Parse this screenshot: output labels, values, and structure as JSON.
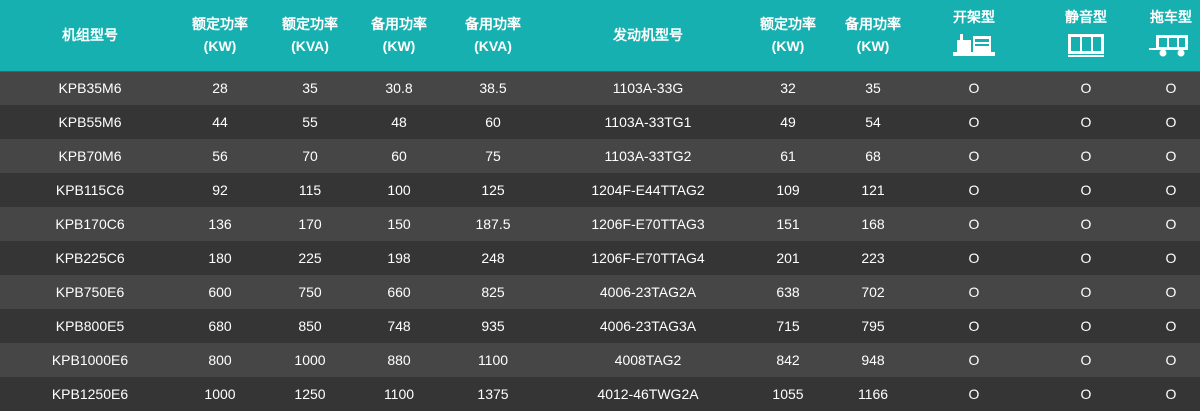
{
  "table": {
    "headers": {
      "model": "机组型号",
      "rated_kw": [
        "额定功率",
        "(KW)"
      ],
      "rated_kva": [
        "额定功率",
        "(KVA)"
      ],
      "standby_kw": [
        "备用功率",
        "(KW)"
      ],
      "standby_kva": [
        "备用功率",
        "(KVA)"
      ],
      "engine": "发动机型号",
      "engine_rated_kw": [
        "额定功率",
        "(KW)"
      ],
      "engine_standby_kw": [
        "备用功率",
        "(KW)"
      ],
      "open_frame": "开架型",
      "silent": "静音型",
      "trailer": "拖车型"
    },
    "rows": [
      [
        "KPB35M6",
        "28",
        "35",
        "30.8",
        "38.5",
        "1103A-33G",
        "32",
        "35",
        "O",
        "O",
        "O"
      ],
      [
        "KPB55M6",
        "44",
        "55",
        "48",
        "60",
        "1103A-33TG1",
        "49",
        "54",
        "O",
        "O",
        "O"
      ],
      [
        "KPB70M6",
        "56",
        "70",
        "60",
        "75",
        "1103A-33TG2",
        "61",
        "68",
        "O",
        "O",
        "O"
      ],
      [
        "KPB115C6",
        "92",
        "115",
        "100",
        "125",
        "1204F-E44TTAG2",
        "109",
        "121",
        "O",
        "O",
        "O"
      ],
      [
        "KPB170C6",
        "136",
        "170",
        "150",
        "187.5",
        "1206F-E70TTAG3",
        "151",
        "168",
        "O",
        "O",
        "O"
      ],
      [
        "KPB225C6",
        "180",
        "225",
        "198",
        "248",
        "1206F-E70TTAG4",
        "201",
        "223",
        "O",
        "O",
        "O"
      ],
      [
        "KPB750E6",
        "600",
        "750",
        "660",
        "825",
        "4006-23TAG2A",
        "638",
        "702",
        "O",
        "O",
        "O"
      ],
      [
        "KPB800E5",
        "680",
        "850",
        "748",
        "935",
        "4006-23TAG3A",
        "715",
        "795",
        "O",
        "O",
        "O"
      ],
      [
        "KPB1000E6",
        "800",
        "1000",
        "880",
        "1100",
        "4008TAG2",
        "842",
        "948",
        "O",
        "O",
        "O"
      ],
      [
        "KPB1250E6",
        "1000",
        "1250",
        "1100",
        "1375",
        "4012-46TWG2A",
        "1055",
        "1166",
        "O",
        "O",
        "O"
      ]
    ]
  },
  "colors": {
    "header_bg": "#16b0b0",
    "row_odd": "#464646",
    "row_even": "#353535",
    "text": "#ffffff"
  },
  "icons": {
    "open_frame": "open-frame-generator-icon",
    "silent": "silent-generator-icon",
    "trailer": "trailer-generator-icon"
  }
}
